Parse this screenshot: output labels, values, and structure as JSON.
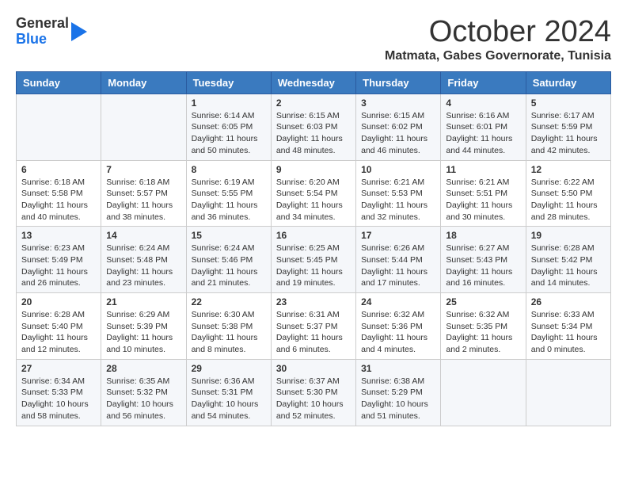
{
  "logo": {
    "line1": "General",
    "line2": "Blue"
  },
  "title": "October 2024",
  "location": "Matmata, Gabes Governorate, Tunisia",
  "days_of_week": [
    "Sunday",
    "Monday",
    "Tuesday",
    "Wednesday",
    "Thursday",
    "Friday",
    "Saturday"
  ],
  "weeks": [
    [
      {
        "day": "",
        "content": ""
      },
      {
        "day": "",
        "content": ""
      },
      {
        "day": "1",
        "content": "Sunrise: 6:14 AM\nSunset: 6:05 PM\nDaylight: 11 hours and 50 minutes."
      },
      {
        "day": "2",
        "content": "Sunrise: 6:15 AM\nSunset: 6:03 PM\nDaylight: 11 hours and 48 minutes."
      },
      {
        "day": "3",
        "content": "Sunrise: 6:15 AM\nSunset: 6:02 PM\nDaylight: 11 hours and 46 minutes."
      },
      {
        "day": "4",
        "content": "Sunrise: 6:16 AM\nSunset: 6:01 PM\nDaylight: 11 hours and 44 minutes."
      },
      {
        "day": "5",
        "content": "Sunrise: 6:17 AM\nSunset: 5:59 PM\nDaylight: 11 hours and 42 minutes."
      }
    ],
    [
      {
        "day": "6",
        "content": "Sunrise: 6:18 AM\nSunset: 5:58 PM\nDaylight: 11 hours and 40 minutes."
      },
      {
        "day": "7",
        "content": "Sunrise: 6:18 AM\nSunset: 5:57 PM\nDaylight: 11 hours and 38 minutes."
      },
      {
        "day": "8",
        "content": "Sunrise: 6:19 AM\nSunset: 5:55 PM\nDaylight: 11 hours and 36 minutes."
      },
      {
        "day": "9",
        "content": "Sunrise: 6:20 AM\nSunset: 5:54 PM\nDaylight: 11 hours and 34 minutes."
      },
      {
        "day": "10",
        "content": "Sunrise: 6:21 AM\nSunset: 5:53 PM\nDaylight: 11 hours and 32 minutes."
      },
      {
        "day": "11",
        "content": "Sunrise: 6:21 AM\nSunset: 5:51 PM\nDaylight: 11 hours and 30 minutes."
      },
      {
        "day": "12",
        "content": "Sunrise: 6:22 AM\nSunset: 5:50 PM\nDaylight: 11 hours and 28 minutes."
      }
    ],
    [
      {
        "day": "13",
        "content": "Sunrise: 6:23 AM\nSunset: 5:49 PM\nDaylight: 11 hours and 26 minutes."
      },
      {
        "day": "14",
        "content": "Sunrise: 6:24 AM\nSunset: 5:48 PM\nDaylight: 11 hours and 23 minutes."
      },
      {
        "day": "15",
        "content": "Sunrise: 6:24 AM\nSunset: 5:46 PM\nDaylight: 11 hours and 21 minutes."
      },
      {
        "day": "16",
        "content": "Sunrise: 6:25 AM\nSunset: 5:45 PM\nDaylight: 11 hours and 19 minutes."
      },
      {
        "day": "17",
        "content": "Sunrise: 6:26 AM\nSunset: 5:44 PM\nDaylight: 11 hours and 17 minutes."
      },
      {
        "day": "18",
        "content": "Sunrise: 6:27 AM\nSunset: 5:43 PM\nDaylight: 11 hours and 16 minutes."
      },
      {
        "day": "19",
        "content": "Sunrise: 6:28 AM\nSunset: 5:42 PM\nDaylight: 11 hours and 14 minutes."
      }
    ],
    [
      {
        "day": "20",
        "content": "Sunrise: 6:28 AM\nSunset: 5:40 PM\nDaylight: 11 hours and 12 minutes."
      },
      {
        "day": "21",
        "content": "Sunrise: 6:29 AM\nSunset: 5:39 PM\nDaylight: 11 hours and 10 minutes."
      },
      {
        "day": "22",
        "content": "Sunrise: 6:30 AM\nSunset: 5:38 PM\nDaylight: 11 hours and 8 minutes."
      },
      {
        "day": "23",
        "content": "Sunrise: 6:31 AM\nSunset: 5:37 PM\nDaylight: 11 hours and 6 minutes."
      },
      {
        "day": "24",
        "content": "Sunrise: 6:32 AM\nSunset: 5:36 PM\nDaylight: 11 hours and 4 minutes."
      },
      {
        "day": "25",
        "content": "Sunrise: 6:32 AM\nSunset: 5:35 PM\nDaylight: 11 hours and 2 minutes."
      },
      {
        "day": "26",
        "content": "Sunrise: 6:33 AM\nSunset: 5:34 PM\nDaylight: 11 hours and 0 minutes."
      }
    ],
    [
      {
        "day": "27",
        "content": "Sunrise: 6:34 AM\nSunset: 5:33 PM\nDaylight: 10 hours and 58 minutes."
      },
      {
        "day": "28",
        "content": "Sunrise: 6:35 AM\nSunset: 5:32 PM\nDaylight: 10 hours and 56 minutes."
      },
      {
        "day": "29",
        "content": "Sunrise: 6:36 AM\nSunset: 5:31 PM\nDaylight: 10 hours and 54 minutes."
      },
      {
        "day": "30",
        "content": "Sunrise: 6:37 AM\nSunset: 5:30 PM\nDaylight: 10 hours and 52 minutes."
      },
      {
        "day": "31",
        "content": "Sunrise: 6:38 AM\nSunset: 5:29 PM\nDaylight: 10 hours and 51 minutes."
      },
      {
        "day": "",
        "content": ""
      },
      {
        "day": "",
        "content": ""
      }
    ]
  ]
}
